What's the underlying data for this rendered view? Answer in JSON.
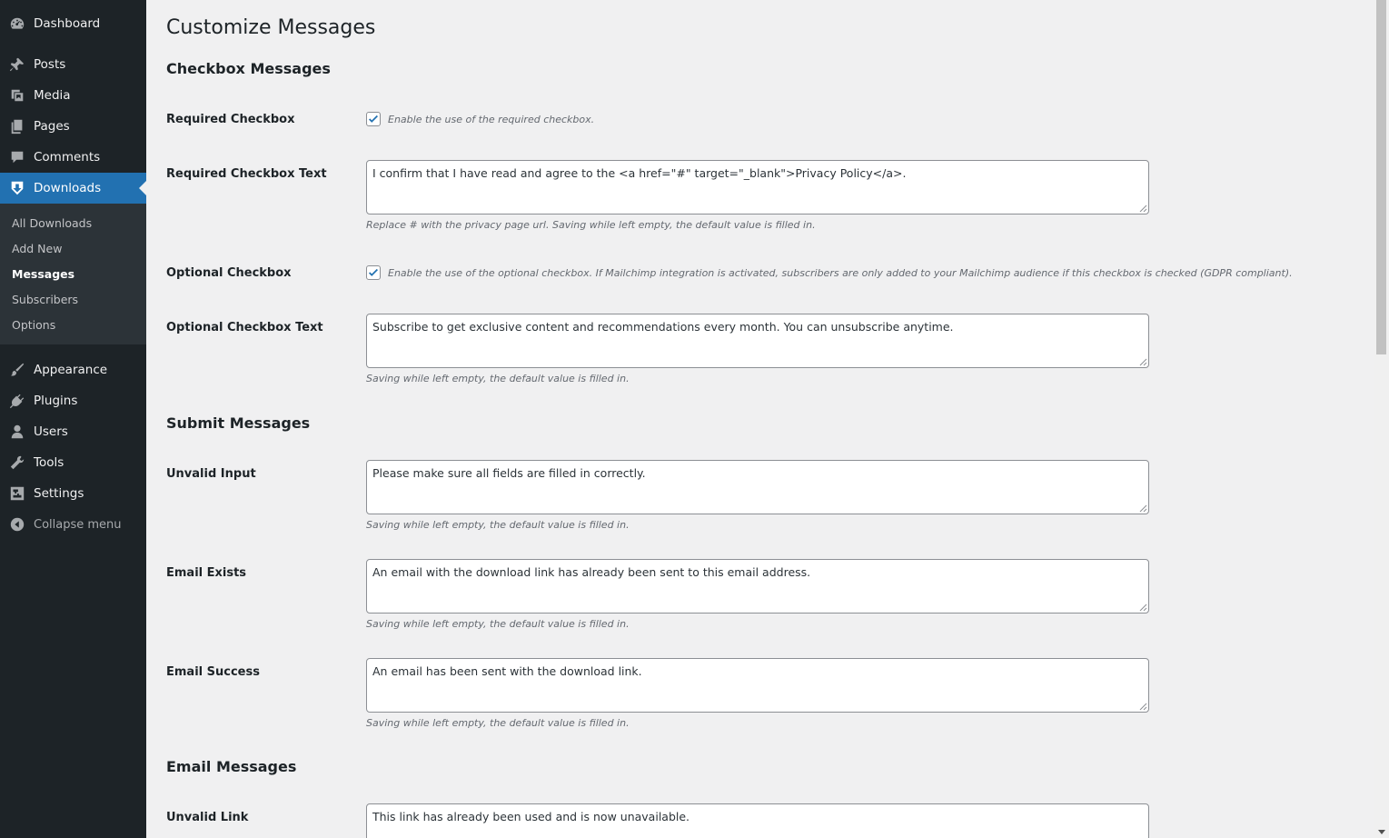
{
  "sidebar": {
    "items": [
      {
        "label": "Dashboard",
        "icon": "dashboard-icon"
      },
      {
        "label": "Posts",
        "icon": "pin-icon"
      },
      {
        "label": "Media",
        "icon": "media-icon"
      },
      {
        "label": "Pages",
        "icon": "pages-icon"
      },
      {
        "label": "Comments",
        "icon": "comment-icon"
      },
      {
        "label": "Downloads",
        "icon": "download-icon"
      },
      {
        "label": "Appearance",
        "icon": "brush-icon"
      },
      {
        "label": "Plugins",
        "icon": "plugin-icon"
      },
      {
        "label": "Users",
        "icon": "user-icon"
      },
      {
        "label": "Tools",
        "icon": "wrench-icon"
      },
      {
        "label": "Settings",
        "icon": "settings-icon"
      },
      {
        "label": "Collapse menu",
        "icon": "collapse-icon"
      }
    ],
    "submenu": [
      "All Downloads",
      "Add New",
      "Messages",
      "Subscribers",
      "Options"
    ]
  },
  "page": {
    "title": "Customize Messages",
    "sections": {
      "checkbox": "Checkbox Messages",
      "submit": "Submit Messages",
      "email": "Email Messages"
    },
    "fields": {
      "required_checkbox": {
        "label": "Required Checkbox",
        "checked": true,
        "description": "Enable the use of the required checkbox."
      },
      "required_checkbox_text": {
        "label": "Required Checkbox Text",
        "value": "I confirm that I have read and agree to the <a href=\"#\" target=\"_blank\">Privacy Policy</a>.",
        "description": "Replace # with the privacy page url. Saving while left empty, the default value is filled in."
      },
      "optional_checkbox": {
        "label": "Optional Checkbox",
        "checked": true,
        "description": "Enable the use of the optional checkbox. If Mailchimp integration is activated, subscribers are only added to your Mailchimp audience if this checkbox is checked (GDPR compliant)."
      },
      "optional_checkbox_text": {
        "label": "Optional Checkbox Text",
        "value": "Subscribe to get exclusive content and recommendations every month. You can unsubscribe anytime.",
        "description": "Saving while left empty, the default value is filled in."
      },
      "unvalid_input": {
        "label": "Unvalid Input",
        "value": "Please make sure all fields are filled in correctly.",
        "description": "Saving while left empty, the default value is filled in."
      },
      "email_exists": {
        "label": "Email Exists",
        "value": "An email with the download link has already been sent to this email address.",
        "description": "Saving while left empty, the default value is filled in."
      },
      "email_success": {
        "label": "Email Success",
        "value": "An email has been sent with the download link.",
        "description": "Saving while left empty, the default value is filled in."
      },
      "unvalid_link": {
        "label": "Unvalid Link",
        "value": "This link has already been used and is now unavailable."
      }
    }
  },
  "colors": {
    "sidebar_bg": "#1d2327",
    "submenu_bg": "#2c3338",
    "accent": "#2271b1",
    "page_bg": "#f0f0f1"
  }
}
